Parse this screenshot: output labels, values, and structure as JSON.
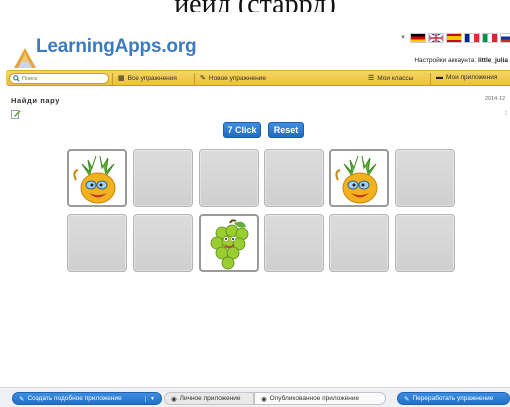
{
  "caption_fragment": "иеид (старрд)",
  "brand": {
    "name": "LearningApps.org"
  },
  "account": {
    "label": "Настройки аккаунта:",
    "user": "little_julia"
  },
  "nav": {
    "search_placeholder": "Поиск",
    "all_exercises": "Все упражнения",
    "new_exercise": "Новое упражнение",
    "my_classes": "Мои классы",
    "my_apps": "Мои приложения"
  },
  "app": {
    "title": "Найди пару",
    "date": "2014-12",
    "clicks_label": "7 Click",
    "reset_label": "Reset"
  },
  "cards": {
    "rows": [
      [
        "pineapple",
        "hidden",
        "hidden",
        "hidden",
        "pineapple",
        "hidden"
      ],
      [
        "hidden",
        "hidden",
        "grapes",
        "hidden",
        "hidden",
        "hidden"
      ]
    ]
  },
  "bottom": {
    "create_similar": "Создать подобное приложение",
    "private_app": "Личное приложение",
    "published_app": "Опубликованное приложение",
    "rework_exercise": "Переработать упражнение"
  },
  "colors": {
    "brand_blue": "#3d7bbf",
    "nav_yellow": "#ecc13d",
    "button_blue": "#2070c8",
    "card_grey": "#d4d4d4"
  },
  "icons": [
    "search-icon",
    "grid-icon",
    "edit-icon",
    "list-icon",
    "folder-icon",
    "eye-icon",
    "pencil-icon"
  ]
}
